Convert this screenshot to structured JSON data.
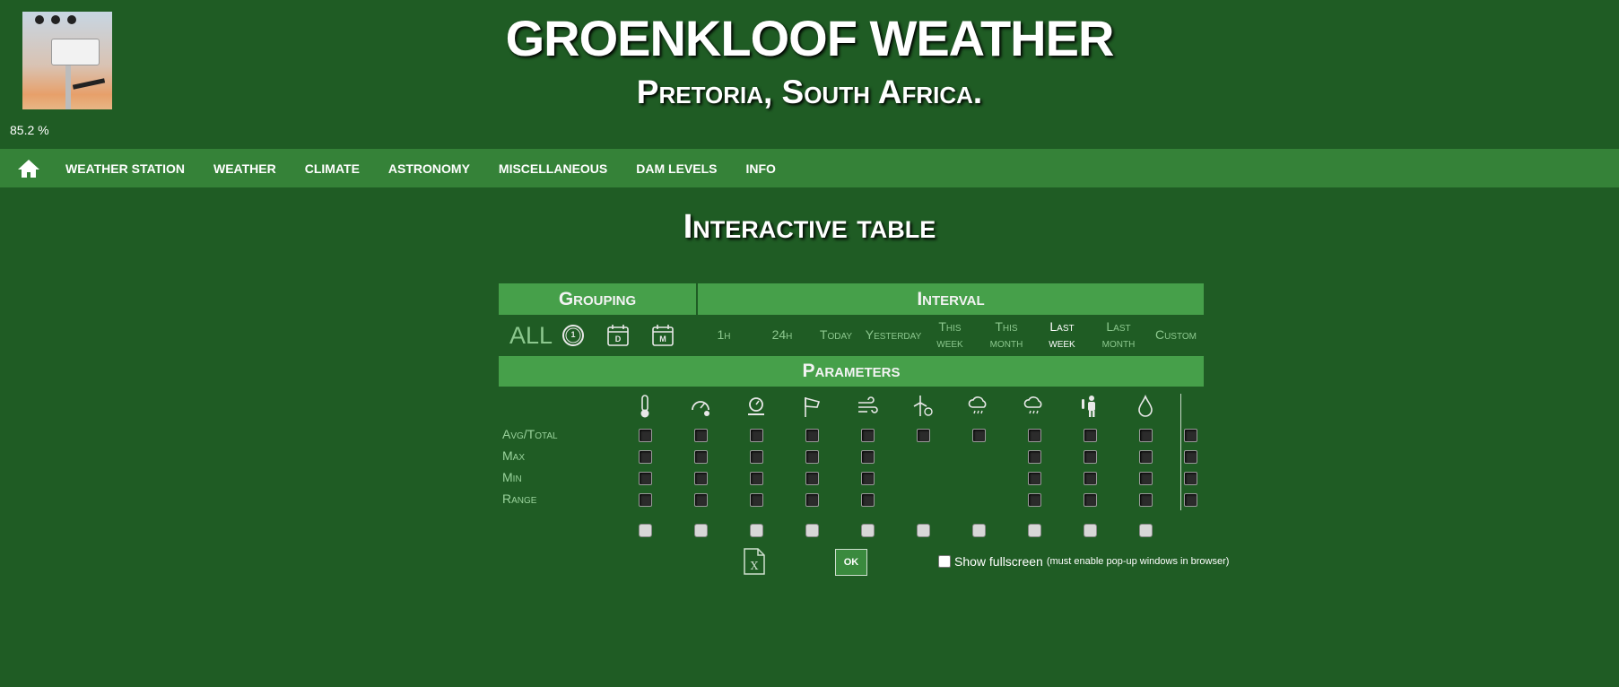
{
  "header": {
    "title": "GROENKLOOF WEATHER",
    "subtitle": "Pretoria, South Africa.",
    "percent": "85.2 %"
  },
  "nav": {
    "items": [
      "WEATHER STATION",
      "WEATHER",
      "CLIMATE",
      "ASTRONOMY",
      "MISCELLANEOUS",
      "DAM LEVELS",
      "INFO"
    ]
  },
  "page": {
    "title": "Interactive table"
  },
  "panel": {
    "grouping_label": "Grouping",
    "interval_label": "Interval",
    "parameters_label": "Parameters",
    "grouping_all": "ALL",
    "grouping_icons": [
      "clock-icon",
      "calendar-day-icon",
      "calendar-month-icon"
    ],
    "grouping_icon_letters": [
      "1",
      "D",
      "M"
    ],
    "intervals": [
      {
        "l1": "1h",
        "l2": ""
      },
      {
        "l1": "24h",
        "l2": ""
      },
      {
        "l1": "Today",
        "l2": ""
      },
      {
        "l1": "Yesterday",
        "l2": ""
      },
      {
        "l1": "This",
        "l2": "week"
      },
      {
        "l1": "This",
        "l2": "month"
      },
      {
        "l1": "Last",
        "l2": "week"
      },
      {
        "l1": "Last",
        "l2": "month"
      },
      {
        "l1": "Custom",
        "l2": ""
      }
    ],
    "active_interval": 6,
    "param_icons": [
      "thermometer-icon",
      "pressure-gauge-icon",
      "gauge-icon",
      "windsock-icon",
      "wind-icon",
      "wind-turbine-icon",
      "rain-cloud-icon",
      "rain-cloud-icon",
      "person-temperature-icon",
      "water-drop-icon"
    ],
    "rows": [
      "Avg/Total",
      "Max",
      "Min",
      "Range"
    ],
    "row_presence": [
      [
        1,
        1,
        1,
        1,
        1,
        1,
        1,
        1,
        1,
        1,
        1
      ],
      [
        1,
        1,
        1,
        1,
        1,
        0,
        0,
        1,
        1,
        1,
        1
      ],
      [
        1,
        1,
        1,
        1,
        1,
        0,
        0,
        1,
        1,
        1,
        1
      ],
      [
        1,
        1,
        1,
        1,
        1,
        0,
        0,
        1,
        1,
        1,
        1
      ]
    ],
    "ok_label": "OK",
    "fullscreen_label": "Show fullscreen",
    "fullscreen_note": "(must enable pop-up windows in browser)"
  },
  "colors": {
    "background": "#1f5c24",
    "nav": "#358238",
    "section_header": "#46a04a",
    "muted_text": "#8cc88e"
  }
}
